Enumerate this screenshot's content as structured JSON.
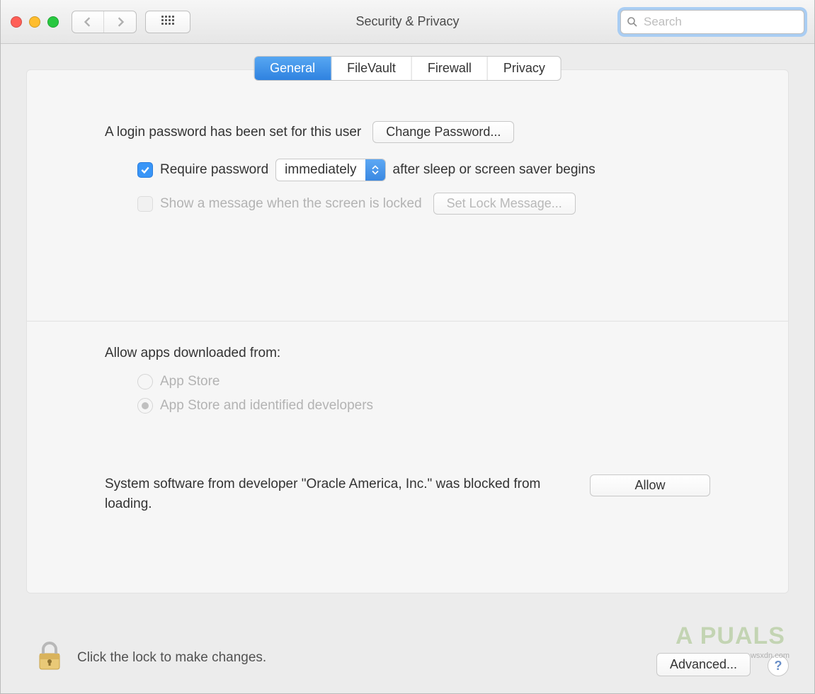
{
  "window": {
    "title": "Security & Privacy",
    "search_placeholder": "Search"
  },
  "tabs": {
    "general": "General",
    "filevault": "FileVault",
    "firewall": "Firewall",
    "privacy": "Privacy"
  },
  "general": {
    "login_password_set": "A login password has been set for this user",
    "change_password_btn": "Change Password...",
    "require_password_label": "Require password",
    "delay_selected": "immediately",
    "after_sleep_suffix": "after sleep or screen saver begins",
    "show_message_label": "Show a message when the screen is locked",
    "set_lock_message_btn": "Set Lock Message...",
    "allow_apps_heading": "Allow apps downloaded from:",
    "radio_app_store": "App Store",
    "radio_identified": "App Store and identified developers",
    "blocked_text": "System software from developer \"Oracle America, Inc.\" was blocked from loading.",
    "allow_btn": "Allow"
  },
  "footer": {
    "lock_hint": "Click the lock to make changes.",
    "advanced_btn": "Advanced...",
    "help_label": "?"
  },
  "watermark": {
    "brand": "A PUALS",
    "site": "wsxdn.com"
  }
}
